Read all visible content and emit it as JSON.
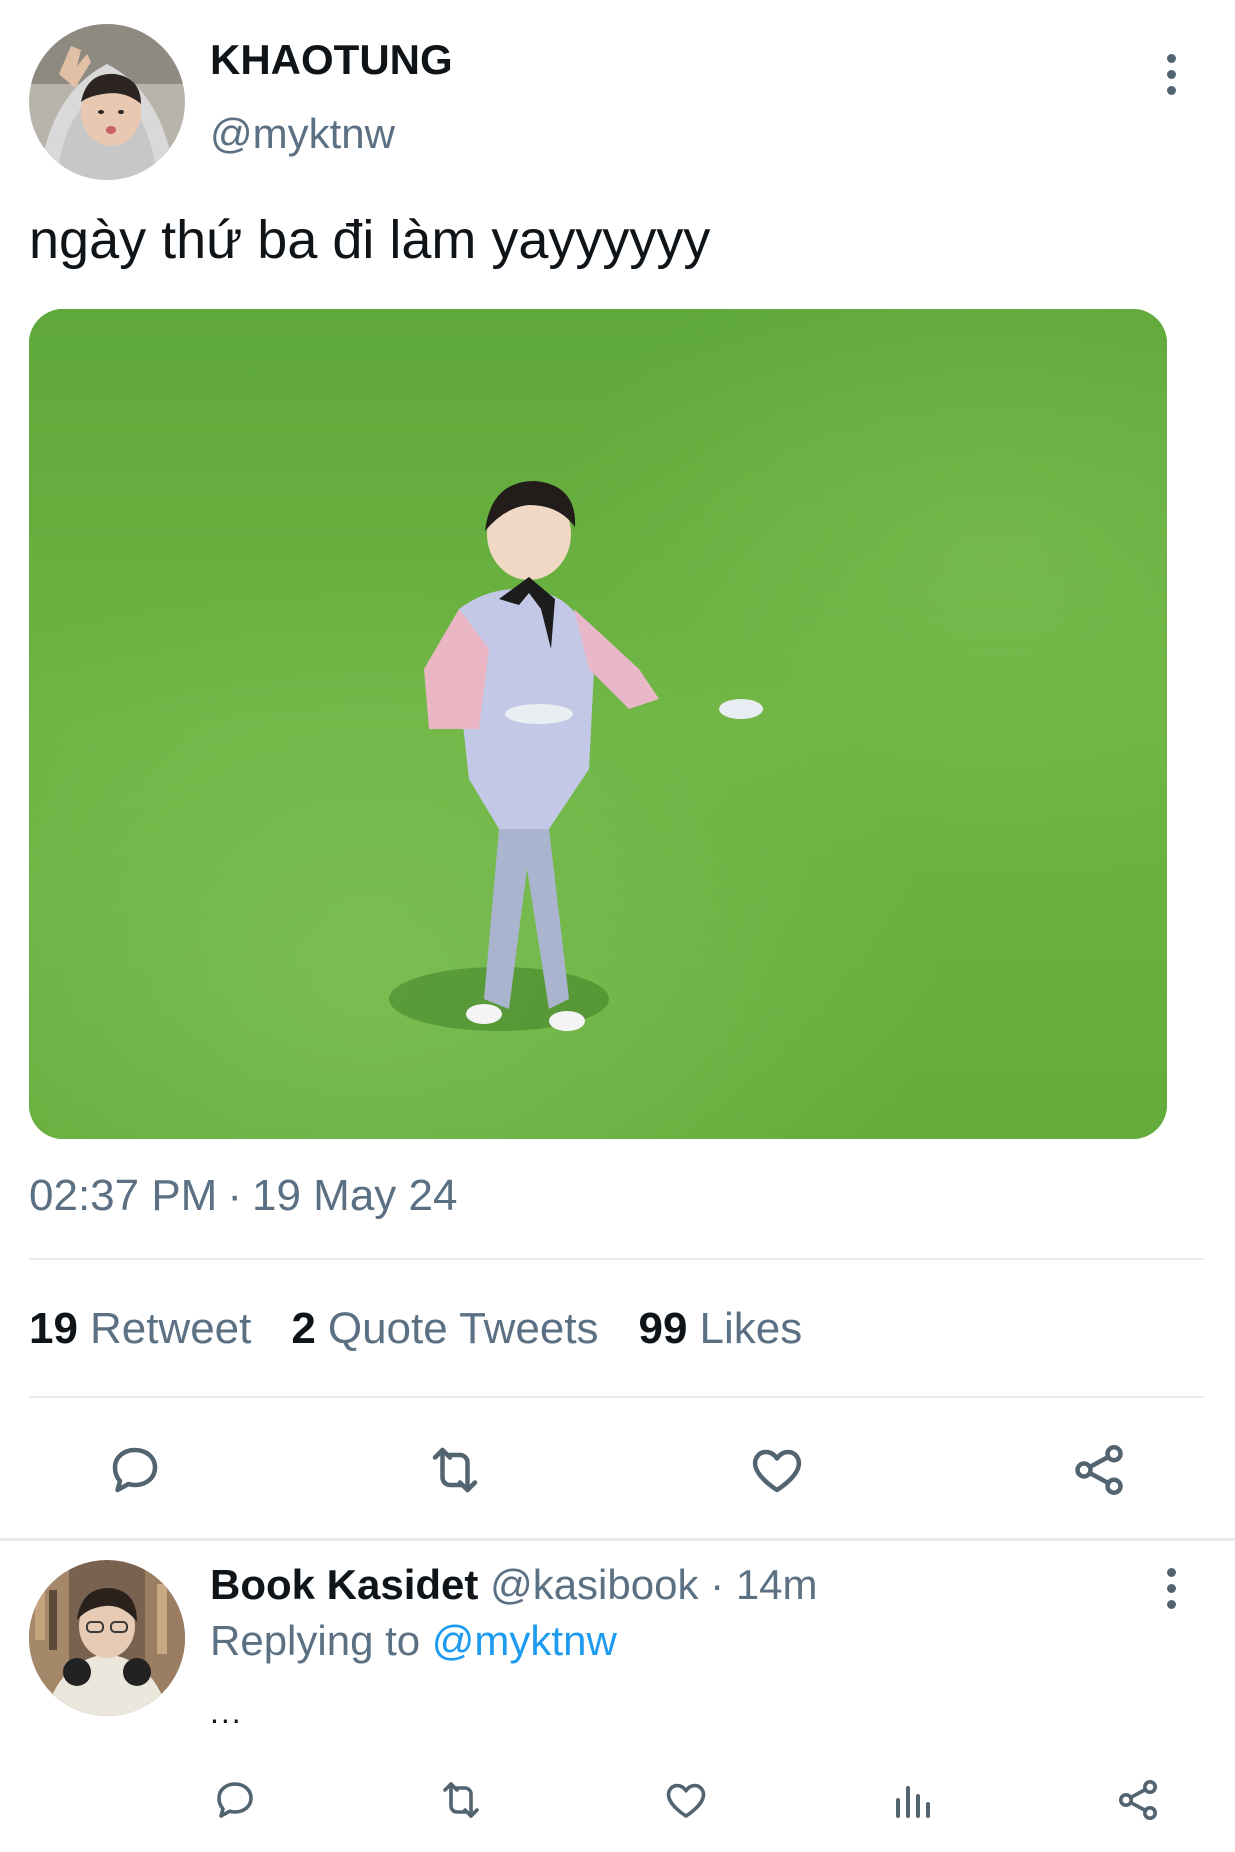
{
  "tweet": {
    "author": {
      "display_name": "KHAOTUNG",
      "handle": "@myktnw"
    },
    "text": "ngày thứ ba đi làm yayyyyyy",
    "time": "02:37 PM",
    "separator": "·",
    "date": "19 May 24",
    "stats": [
      {
        "count": "19",
        "label": "Retweet"
      },
      {
        "count": "2",
        "label": "Quote Tweets"
      },
      {
        "count": "99",
        "label": "Likes"
      }
    ],
    "actions": [
      "reply-icon",
      "retweet-icon",
      "heart-icon",
      "share-icon"
    ]
  },
  "reply": {
    "author": {
      "display_name": "Book Kasidet",
      "handle": "@kasibook"
    },
    "separator": "·",
    "time": "14m",
    "replying_prefix": "Replying to",
    "replying_mention": "@myktnw",
    "text": "...",
    "actions": [
      "reply-icon",
      "retweet-icon",
      "heart-icon",
      "analytics-icon",
      "share-icon"
    ]
  },
  "colors": {
    "text_primary": "#0f1419",
    "text_secondary": "#5b7083",
    "link": "#1d9bf0",
    "divider": "#e6ecf0",
    "grass": "#6fb43f"
  }
}
